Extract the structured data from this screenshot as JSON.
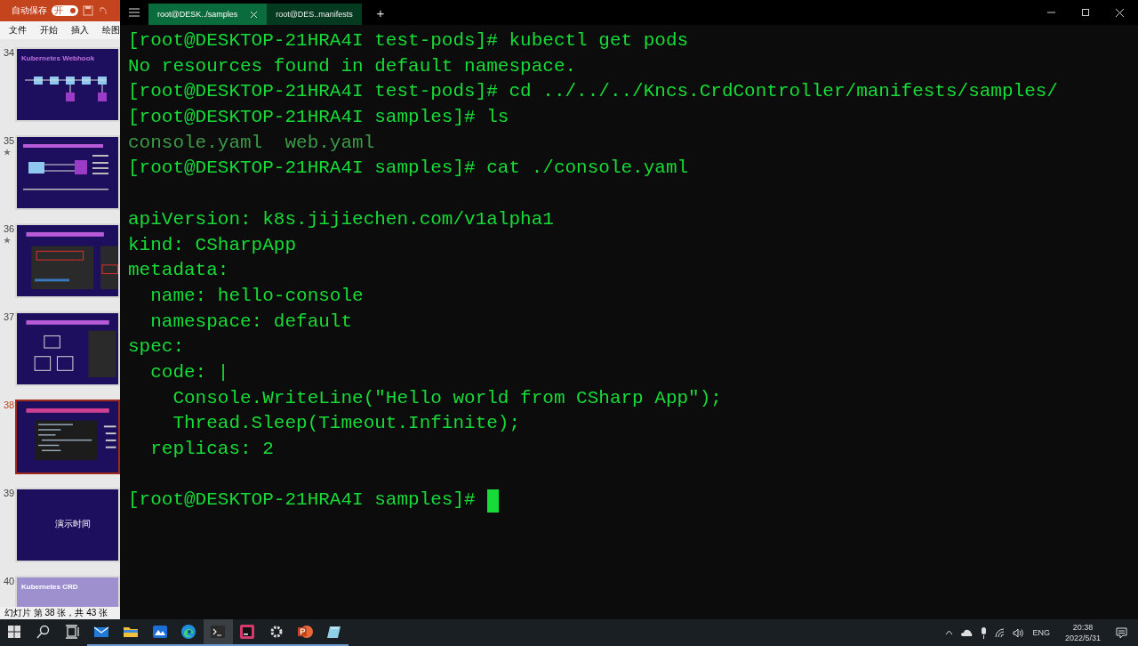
{
  "presentation": {
    "autosave_label": "自动保存",
    "autosave_toggle": {
      "label": "开",
      "on": true
    },
    "menu": [
      "文件",
      "开始",
      "插入",
      "绘图"
    ],
    "slides": [
      {
        "number": "34",
        "starred": false,
        "selected": false,
        "kind": "diagram",
        "title": "Kubernetes Webhook"
      },
      {
        "number": "35",
        "starred": true,
        "selected": false,
        "kind": "flow"
      },
      {
        "number": "36",
        "starred": true,
        "selected": false,
        "kind": "screens"
      },
      {
        "number": "37",
        "starred": false,
        "selected": false,
        "kind": "boxes"
      },
      {
        "number": "38",
        "starred": false,
        "selected": true,
        "kind": "code"
      },
      {
        "number": "39",
        "starred": false,
        "selected": false,
        "kind": "blank",
        "title": "演示时间"
      },
      {
        "number": "40",
        "starred": false,
        "selected": false,
        "kind": "light",
        "title": "Kubernetes CRD"
      }
    ],
    "status": "幻灯片 第 38 张，共 43 张"
  },
  "terminal": {
    "tabs": [
      {
        "label": "root@DESK../samples",
        "selected": true
      },
      {
        "label": "root@DES..manifests",
        "selected": false
      }
    ],
    "new_tab": "+",
    "lines": [
      {
        "kind": "bright",
        "text": "[root@DESKTOP-21HRA4I test-pods]# kubectl get pods"
      },
      {
        "kind": "bright",
        "text": "No resources found in default namespace."
      },
      {
        "kind": "bright",
        "text": "[root@DESKTOP-21HRA4I test-pods]# cd ../../../Kncs.CrdController/manifests/samples/"
      },
      {
        "kind": "bright",
        "text": "[root@DESKTOP-21HRA4I samples]# ls"
      },
      {
        "kind": "dim",
        "text": "console.yaml  web.yaml"
      },
      {
        "kind": "bright",
        "text": "[root@DESKTOP-21HRA4I samples]# cat ./console.yaml"
      },
      {
        "kind": "blank"
      },
      {
        "kind": "bright",
        "text": "apiVersion: k8s.jijiechen.com/v1alpha1"
      },
      {
        "kind": "bright",
        "text": "kind: CSharpApp"
      },
      {
        "kind": "bright",
        "text": "metadata:"
      },
      {
        "kind": "bright",
        "text": "  name: hello-console"
      },
      {
        "kind": "bright",
        "text": "  namespace: default"
      },
      {
        "kind": "bright",
        "text": "spec:"
      },
      {
        "kind": "bright",
        "text": "  code: |"
      },
      {
        "kind": "bright",
        "text": "    Console.WriteLine(\"Hello world from CSharp App\");"
      },
      {
        "kind": "bright",
        "text": "    Thread.Sleep(Timeout.Infinite);"
      },
      {
        "kind": "bright",
        "text": "  replicas: 2"
      },
      {
        "kind": "blank"
      },
      {
        "kind": "bright",
        "text": "[root@DESKTOP-21HRA4I samples]# ",
        "cursor": true
      }
    ]
  },
  "taskbar": {
    "items": [
      {
        "kind": "start",
        "open": false,
        "active": false
      },
      {
        "kind": "search",
        "open": false,
        "active": false
      },
      {
        "kind": "taskview",
        "open": false,
        "active": false
      },
      {
        "kind": "mail",
        "open": true,
        "active": false
      },
      {
        "kind": "files",
        "open": true,
        "active": false
      },
      {
        "kind": "whiteboard",
        "open": true,
        "active": false
      },
      {
        "kind": "browser",
        "open": true,
        "active": false
      },
      {
        "kind": "terminal",
        "open": true,
        "active": true
      },
      {
        "kind": "ide",
        "open": true,
        "active": false
      },
      {
        "kind": "settings",
        "open": true,
        "active": false
      },
      {
        "kind": "slides",
        "open": true,
        "active": false
      },
      {
        "kind": "notepad",
        "open": true,
        "active": false
      }
    ],
    "language": "ENG",
    "time": "20:38",
    "date": "2022/5/31"
  }
}
